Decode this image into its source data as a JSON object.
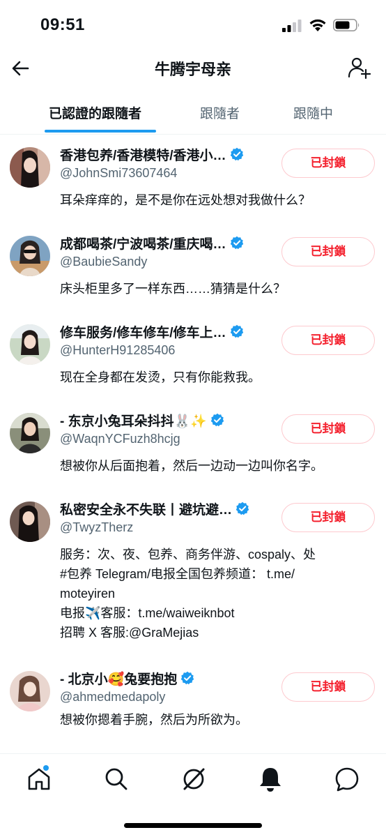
{
  "status_bar": {
    "time": "09:51"
  },
  "header": {
    "title": "牛腾宇母亲"
  },
  "tabs": [
    {
      "label": "已認證的跟隨者",
      "active": true
    },
    {
      "label": "跟隨者",
      "active": false
    },
    {
      "label": "跟隨中",
      "active": false
    }
  ],
  "accounts": [
    {
      "name": "香港包养/香港模特/香港小…",
      "handle": "@JohnSmi73607464",
      "button": "已封鎖",
      "bio": [
        "耳朵痒痒的，是不是你在远处想对我做什么？"
      ]
    },
    {
      "name": "成都喝茶/宁波喝茶/重庆喝…",
      "handle": "@BaubieSandy",
      "button": "已封鎖",
      "bio": [
        "床头柜里多了一样东西……猜猜是什么？"
      ]
    },
    {
      "name": "修车服务/修车修车/修车上…",
      "handle": "@HunterH91285406",
      "button": "已封鎖",
      "bio": [
        "现在全身都在发烫，只有你能救我。"
      ]
    },
    {
      "name": "- 东京小兔耳朵抖抖🐰✨",
      "handle": "@WaqnYCFuzh8hcjg",
      "button": "已封鎖",
      "bio": [
        "想被你从后面抱着，然后一边动一边叫你名字。"
      ]
    },
    {
      "name": "私密安全永不失联丨避坑避…",
      "handle": "@TwyzTherz",
      "button": "已封鎖",
      "bio": [
        "服务：次、夜、包养、商务伴游、cospaly、处",
        "#包养 Telegram/电报全国包养频道： t.me/",
        "moteyiren",
        "电报✈️客服：t.me/waiweiknbot",
        "招聘 X 客服:@GraMejias"
      ]
    },
    {
      "name": "- 北京小🥰兔要抱抱",
      "handle": "@ahmedmedapoly",
      "button": "已封鎖",
      "bio": [
        "想被你摁着手腕，然后为所欲为。"
      ]
    }
  ],
  "colors": {
    "accent": "#1d9bf0",
    "blocked_text": "#f4212e",
    "blocked_border": "#fdc9ce",
    "secondary_text": "#536471"
  },
  "icons": {
    "header": [
      "back-arrow-icon",
      "add-user-icon"
    ],
    "bottom_nav": [
      "home-icon",
      "search-icon",
      "grok-icon",
      "notifications-bell-icon",
      "messages-icon"
    ]
  }
}
